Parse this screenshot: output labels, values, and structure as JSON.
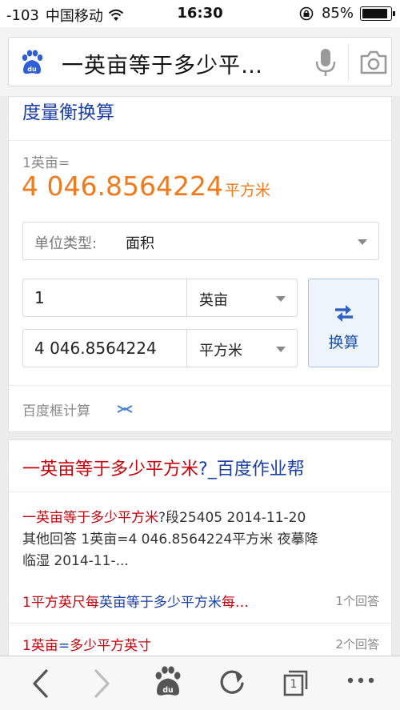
{
  "status_bar": {
    "signal": "-103",
    "carrier": "中国移动",
    "time": "16:30",
    "battery_text": "85%",
    "battery_level": 0.85
  },
  "search": {
    "query": "一英亩等于多少平…"
  },
  "converter": {
    "title": "度量衡换算",
    "from_text": "1英亩=",
    "result_value": "4 046.8564224",
    "result_unit": "平方米",
    "type_label": "单位类型:",
    "type_value": "面积",
    "row1_value": "1",
    "row1_unit": "英亩",
    "row2_value": "4 046.8564224",
    "row2_unit": "平方米",
    "swap_label": "换算",
    "footer": "百度框计算"
  },
  "result2": {
    "title_hl": "一英亩等于多少平方米",
    "title_rest": "?_百度作业帮",
    "snippet_hl": "一英亩等于多少平方米",
    "snippet_1": "?段25405 2014-11-20",
    "snippet_2": "其他回答 1英亩=4 046.8564224平方米 夜摹降",
    "snippet_3": "临湿 2014-11-...",
    "related": [
      {
        "pre": "1平方英尺每",
        "hl1": "英亩等于多少平方米",
        "post": "每…",
        "count": "1个回答"
      },
      {
        "pre": "1英亩",
        "hl1": "=",
        "post": "多少平方英寸",
        "count": "2个回答"
      }
    ]
  },
  "toolbar": {
    "tab_count": "1"
  },
  "colors": {
    "link_blue": "#1b3fa8",
    "highlight_red": "#c7000b",
    "result_orange": "#f27a1c",
    "swap_bg": "#eef4fc"
  },
  "icons": [
    "wifi-icon",
    "lock-rotation-icon",
    "battery-icon",
    "baidu-paw-icon",
    "microphone-icon",
    "camera-icon",
    "swap-arrows-icon",
    "back-icon",
    "forward-icon",
    "home-icon",
    "refresh-icon",
    "tabs-icon",
    "more-icon"
  ]
}
